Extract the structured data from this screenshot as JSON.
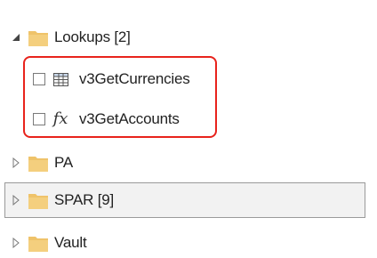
{
  "tree": {
    "lookups": {
      "label": "Lookups [2]",
      "expander": "expanded-triangle",
      "icon": "folder-icon",
      "items": [
        {
          "label": "v3GetCurrencies",
          "icon": "table-icon",
          "checked": false
        },
        {
          "label": "v3GetAccounts",
          "icon": "function-icon",
          "checked": false
        }
      ]
    },
    "pa": {
      "label": "PA",
      "expander": "collapsed-triangle",
      "icon": "folder-icon"
    },
    "spar": {
      "label": "SPAR [9]",
      "expander": "collapsed-triangle",
      "icon": "folder-icon",
      "selected": true
    },
    "vault": {
      "label": "Vault",
      "expander": "collapsed-triangle",
      "icon": "folder-icon"
    }
  },
  "colors": {
    "folder": "#efc36a",
    "folder_dark": "#e2ad4c",
    "highlight": "#e8231c",
    "selected_bg": "#f2f2f2",
    "selected_border": "#9a9a9a"
  }
}
